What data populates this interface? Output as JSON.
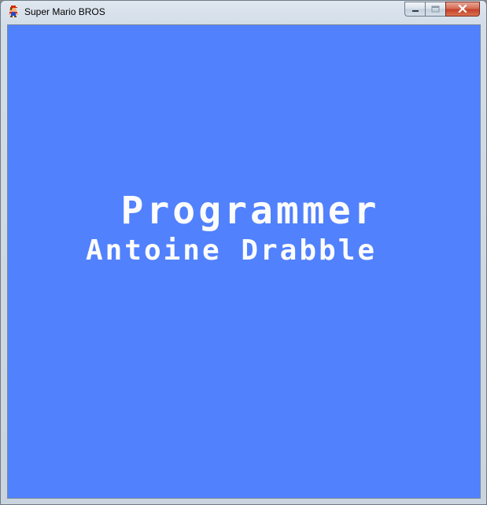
{
  "window": {
    "title": "Super Mario BROS",
    "icon": "mario-sprite-icon",
    "controls": {
      "minimize_icon": "minimize-icon",
      "maximize_icon": "maximize-icon",
      "close_icon": "close-icon"
    }
  },
  "game": {
    "background_color": "#5181fd",
    "text_color": "#fcfcfc",
    "credits": {
      "role": "Programmer",
      "name": "Antoine Drabble"
    }
  }
}
